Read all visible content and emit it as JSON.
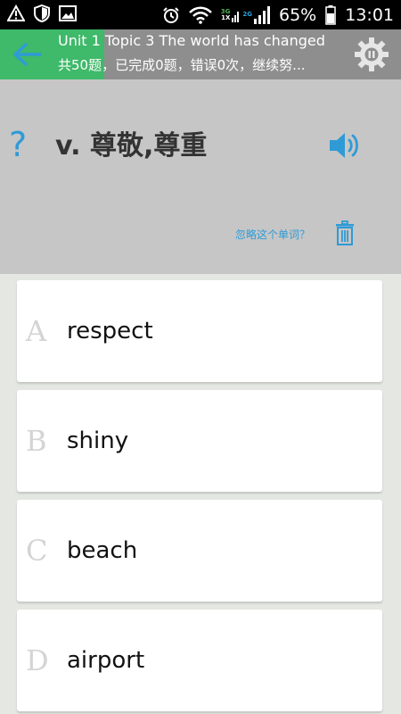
{
  "status_bar": {
    "time": "13:01",
    "battery": "65%",
    "network_3g": "3G",
    "network_1x": "1X",
    "network_2g": "2G",
    "icons": [
      "warning-icon",
      "shield-icon",
      "image-icon",
      "alarm-icon",
      "wifi-icon",
      "signal-icon",
      "battery-icon"
    ]
  },
  "header": {
    "title": "Unit 1 Topic 3 The world has changed",
    "subtitle": "共50题，已完成0题，错误0次，继续努...",
    "progress": 0.26,
    "colors": {
      "progress": "#3fb96a",
      "back": "#2f9bd6"
    }
  },
  "question": {
    "prompt_icon": "?",
    "word": "v. 尊敬,尊重",
    "ignore_label": "忽略这个单词？",
    "accent": "#2f9bd6"
  },
  "options": [
    {
      "letter": "A",
      "text": "respect"
    },
    {
      "letter": "B",
      "text": "shiny"
    },
    {
      "letter": "C",
      "text": "beach"
    },
    {
      "letter": "D",
      "text": "airport"
    }
  ]
}
